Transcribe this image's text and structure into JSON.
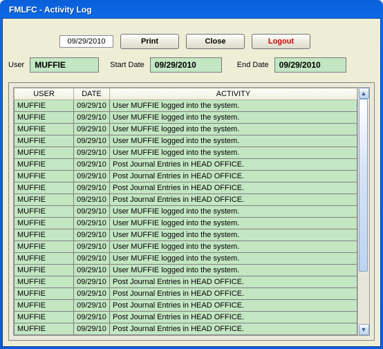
{
  "titlebar": {
    "text": "FMLFC - Activity Log"
  },
  "toolbar": {
    "date_display": "09/29/2010",
    "print_label": "Print",
    "close_label": "Close",
    "logout_label": "Logout"
  },
  "filters": {
    "user_label": "User",
    "user_value": "MUFFIE",
    "start_label": "Start Date",
    "start_value": "09/29/2010",
    "end_label": "End Date",
    "end_value": "09/29/2010"
  },
  "table": {
    "headers": {
      "user": "USER",
      "date": "DATE",
      "activity": "ACTIVITY"
    },
    "rows": [
      {
        "user": "MUFFIE",
        "date": "09/29/10",
        "activity": "User MUFFIE logged into the system."
      },
      {
        "user": "MUFFIE",
        "date": "09/29/10",
        "activity": "User MUFFIE logged into the system."
      },
      {
        "user": "MUFFIE",
        "date": "09/29/10",
        "activity": "User MUFFIE logged into the system."
      },
      {
        "user": "MUFFIE",
        "date": "09/29/10",
        "activity": "User MUFFIE logged into the system."
      },
      {
        "user": "MUFFIE",
        "date": "09/29/10",
        "activity": "User MUFFIE logged into the system."
      },
      {
        "user": "MUFFIE",
        "date": "09/29/10",
        "activity": "Post Journal Entries in HEAD OFFICE."
      },
      {
        "user": "MUFFIE",
        "date": "09/29/10",
        "activity": "Post Journal Entries in HEAD OFFICE."
      },
      {
        "user": "MUFFIE",
        "date": "09/29/10",
        "activity": "Post Journal Entries in HEAD OFFICE."
      },
      {
        "user": "MUFFIE",
        "date": "09/29/10",
        "activity": "Post Journal Entries in HEAD OFFICE."
      },
      {
        "user": "MUFFIE",
        "date": "09/29/10",
        "activity": "User MUFFIE logged into the system."
      },
      {
        "user": "MUFFIE",
        "date": "09/29/10",
        "activity": "User MUFFIE logged into the system."
      },
      {
        "user": "MUFFIE",
        "date": "09/29/10",
        "activity": "User MUFFIE logged into the system."
      },
      {
        "user": "MUFFIE",
        "date": "09/29/10",
        "activity": "User MUFFIE logged into the system."
      },
      {
        "user": "MUFFIE",
        "date": "09/29/10",
        "activity": "User MUFFIE logged into the system."
      },
      {
        "user": "MUFFIE",
        "date": "09/29/10",
        "activity": "User MUFFIE logged into the system."
      },
      {
        "user": "MUFFIE",
        "date": "09/29/10",
        "activity": "Post Journal Entries in HEAD OFFICE."
      },
      {
        "user": "MUFFIE",
        "date": "09/29/10",
        "activity": "Post Journal Entries in HEAD OFFICE."
      },
      {
        "user": "MUFFIE",
        "date": "09/29/10",
        "activity": "Post Journal Entries in HEAD OFFICE."
      },
      {
        "user": "MUFFIE",
        "date": "09/29/10",
        "activity": "Post Journal Entries in HEAD OFFICE."
      },
      {
        "user": "MUFFIE",
        "date": "09/29/10",
        "activity": "Post Journal Entries in HEAD OFFICE."
      }
    ]
  },
  "scroll": {
    "up_glyph": "▲",
    "down_glyph": "▼"
  }
}
